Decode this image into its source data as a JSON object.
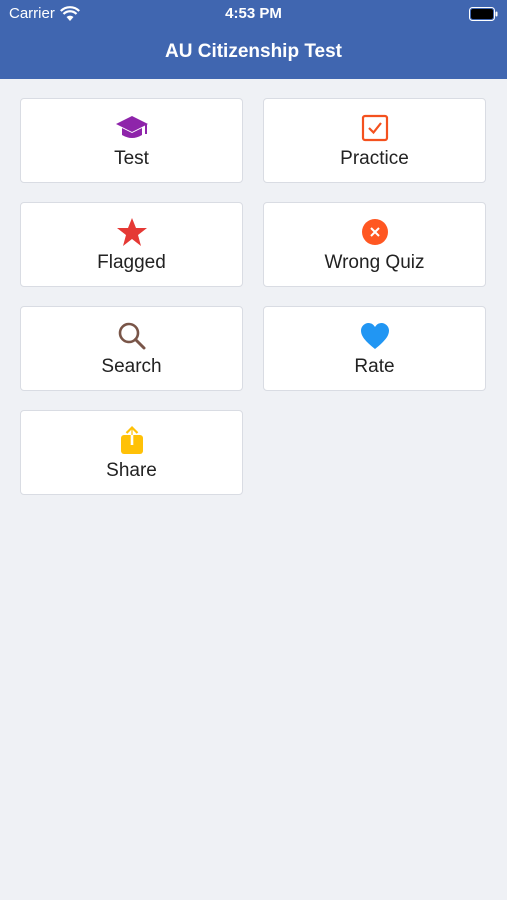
{
  "status_bar": {
    "carrier": "Carrier",
    "time": "4:53 PM"
  },
  "nav": {
    "title": "AU Citizenship Test"
  },
  "menu": {
    "items": [
      {
        "label": "Test",
        "icon": "graduation-cap-icon",
        "color": "#8e24aa"
      },
      {
        "label": "Practice",
        "icon": "checkbox-icon",
        "color": "#f4511e"
      },
      {
        "label": "Flagged",
        "icon": "star-icon",
        "color": "#e53935"
      },
      {
        "label": "Wrong Quiz",
        "icon": "x-circle-icon",
        "color": "#ff5722"
      },
      {
        "label": "Search",
        "icon": "search-icon",
        "color": "#795548"
      },
      {
        "label": "Rate",
        "icon": "heart-icon",
        "color": "#2196f3"
      },
      {
        "label": "Share",
        "icon": "share-icon",
        "color": "#ffc107"
      }
    ]
  },
  "colors": {
    "header": "#4066b0",
    "background": "#eff1f5"
  }
}
